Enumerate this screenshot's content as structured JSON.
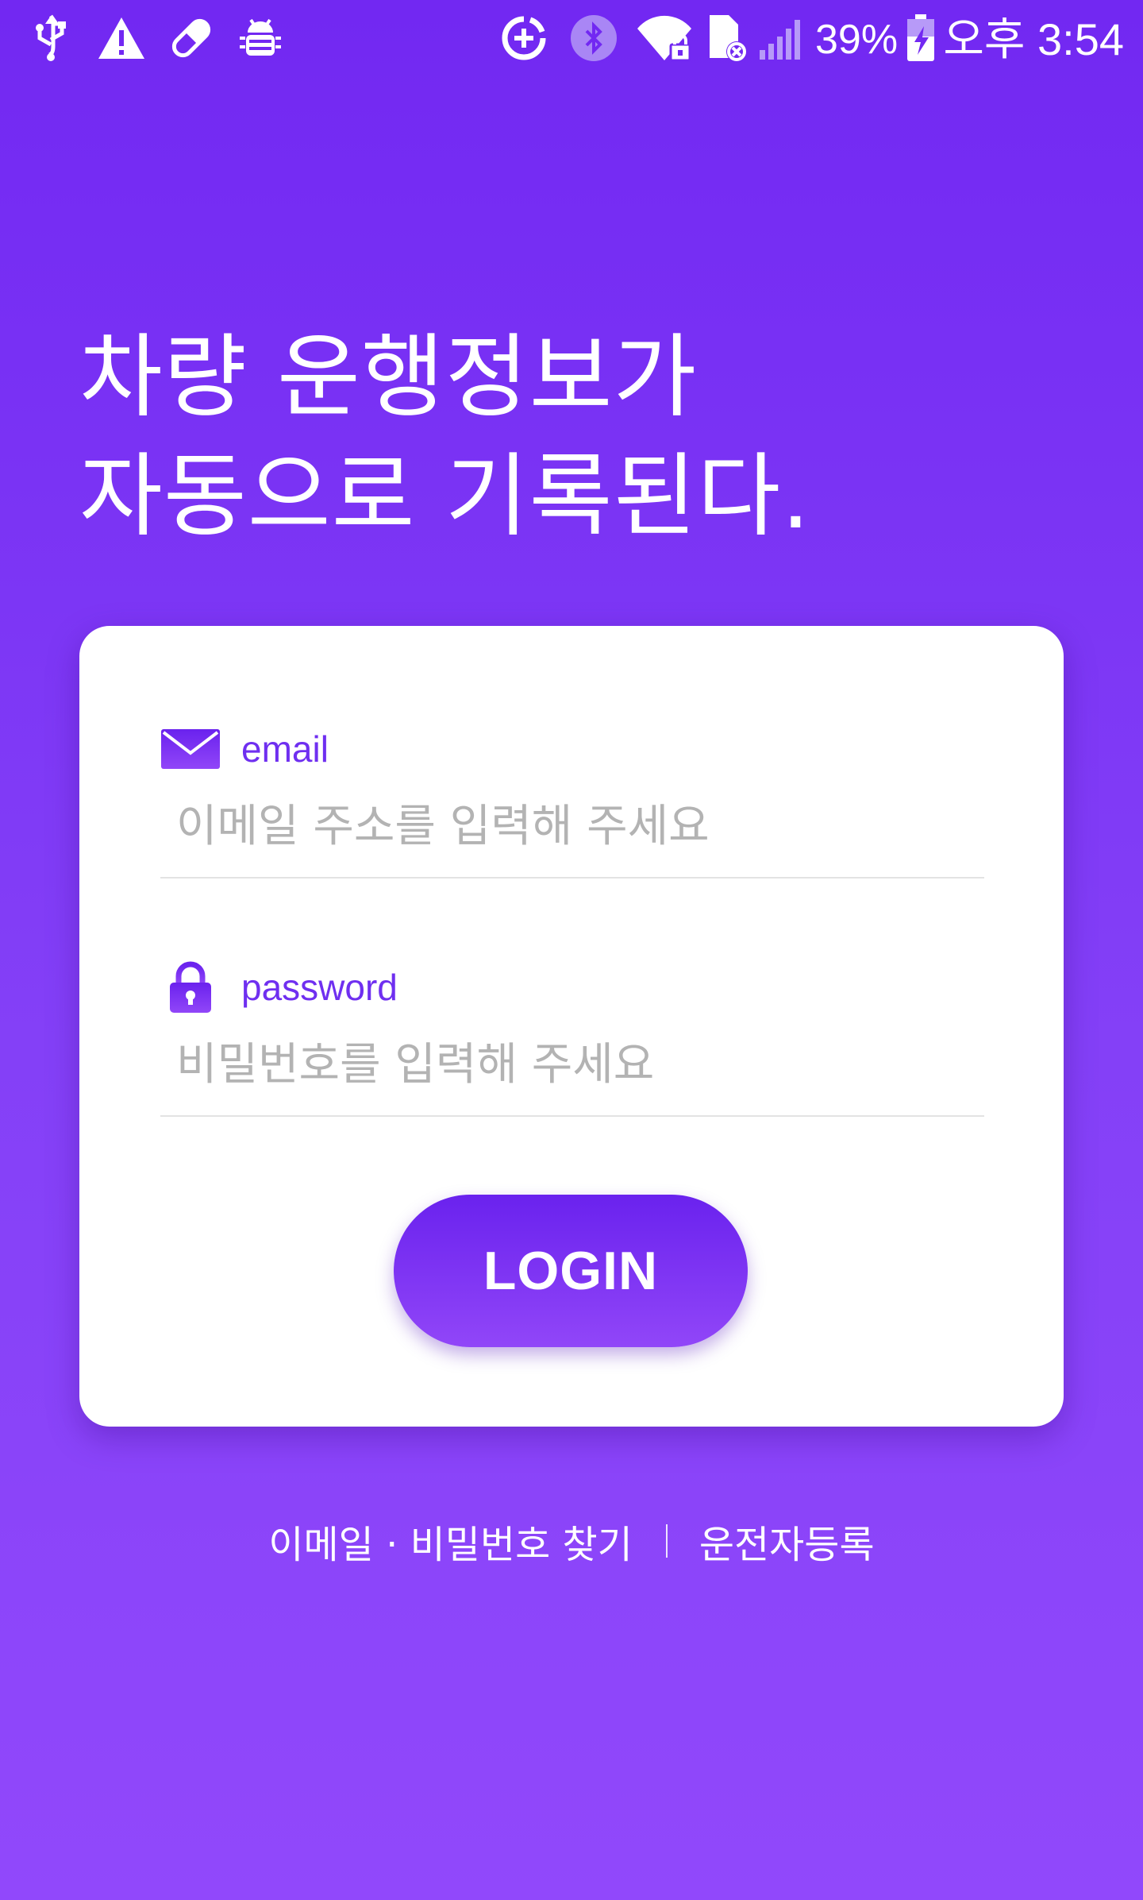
{
  "status_bar": {
    "battery_percent": "39%",
    "time": "오후 3:54",
    "icons": [
      "usb-icon",
      "warning-icon",
      "pill-icon",
      "android-bug-icon",
      "data-saver-icon",
      "bluetooth-icon",
      "wifi-lock-icon",
      "no-sim-icon",
      "signal-icon",
      "battery-charging-icon"
    ]
  },
  "headline": {
    "line1": "차량 운행정보가",
    "line2": "자동으로 기록된다."
  },
  "login_form": {
    "email": {
      "label": "email",
      "placeholder": "이메일 주소를 입력해 주세요",
      "value": "",
      "icon": "envelope-icon"
    },
    "password": {
      "label": "password",
      "placeholder": "비밀번호를 입력해 주세요",
      "value": "",
      "icon": "lock-icon"
    },
    "login_button_label": "LOGIN"
  },
  "bottom_links": {
    "find_account": "이메일 · 비밀번호 찾기",
    "register": "운전자등록"
  },
  "colors": {
    "background_top": "#7228f2",
    "background_bottom": "#9148fb",
    "accent": "#6f2ff0",
    "placeholder": "#b3b3b3",
    "card": "#ffffff"
  }
}
